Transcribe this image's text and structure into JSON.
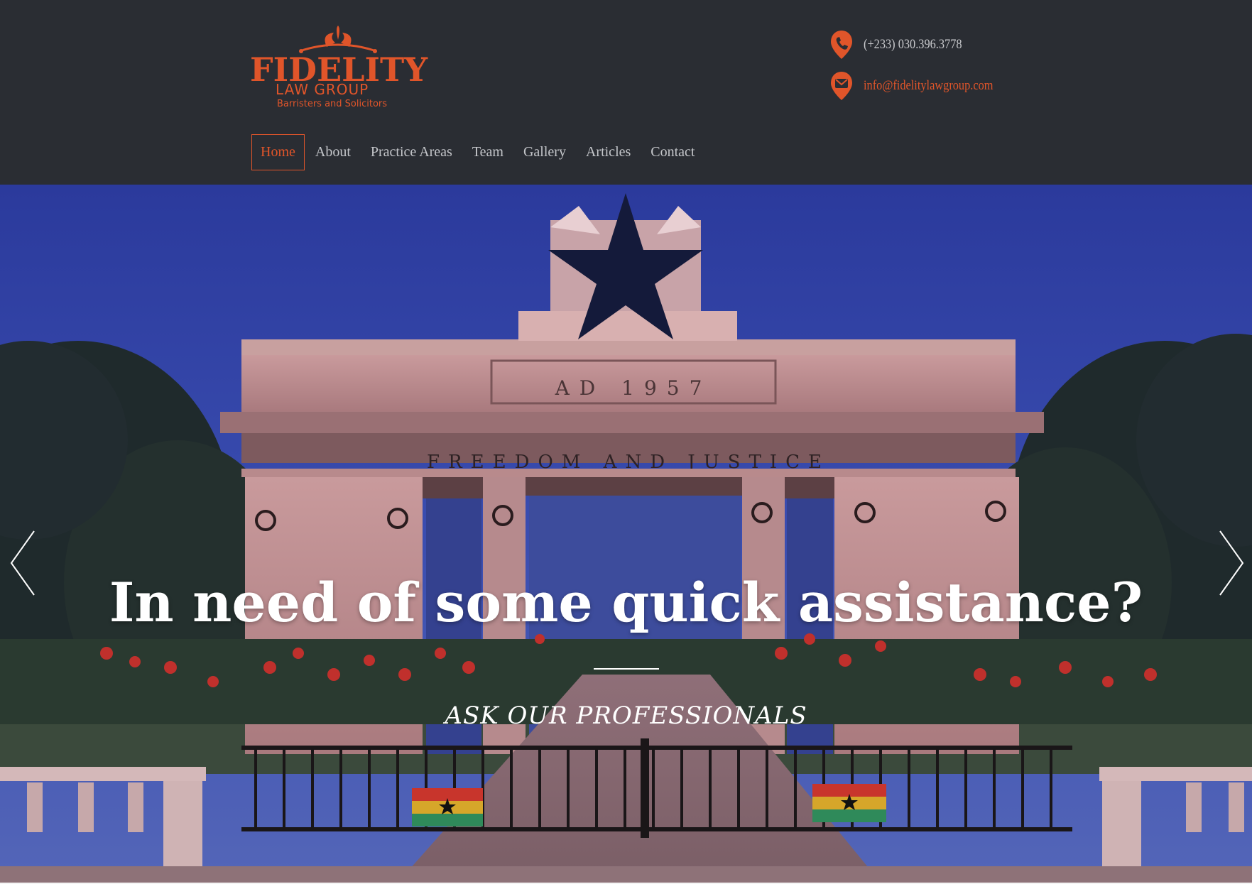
{
  "brand": {
    "name": "FIDELITY",
    "line2": "LAW GROUP",
    "tagline": "Barristers and Solicitors",
    "accent": "#e0552a",
    "header_bg": "#2a2d33"
  },
  "contact": {
    "phone": "(+233) 030.396.3778",
    "phone_icon": "phone-icon",
    "email": "info@fidelitylawgroup.com",
    "email_icon": "envelope-icon"
  },
  "nav": {
    "items": [
      {
        "label": "Home",
        "active": true
      },
      {
        "label": "About"
      },
      {
        "label": "Practice Areas"
      },
      {
        "label": "Team"
      },
      {
        "label": "Gallery"
      },
      {
        "label": "Articles"
      },
      {
        "label": "Contact"
      }
    ]
  },
  "hero": {
    "title": "In need of some quick assistance?",
    "subtitle": "ASK OUR PROFESSIONALS",
    "monument_inscription_top": "AD 1957",
    "monument_inscription_bottom": "FREEDOM AND JUSTICE",
    "prev_icon": "chevron-left-icon",
    "next_icon": "chevron-right-icon"
  }
}
